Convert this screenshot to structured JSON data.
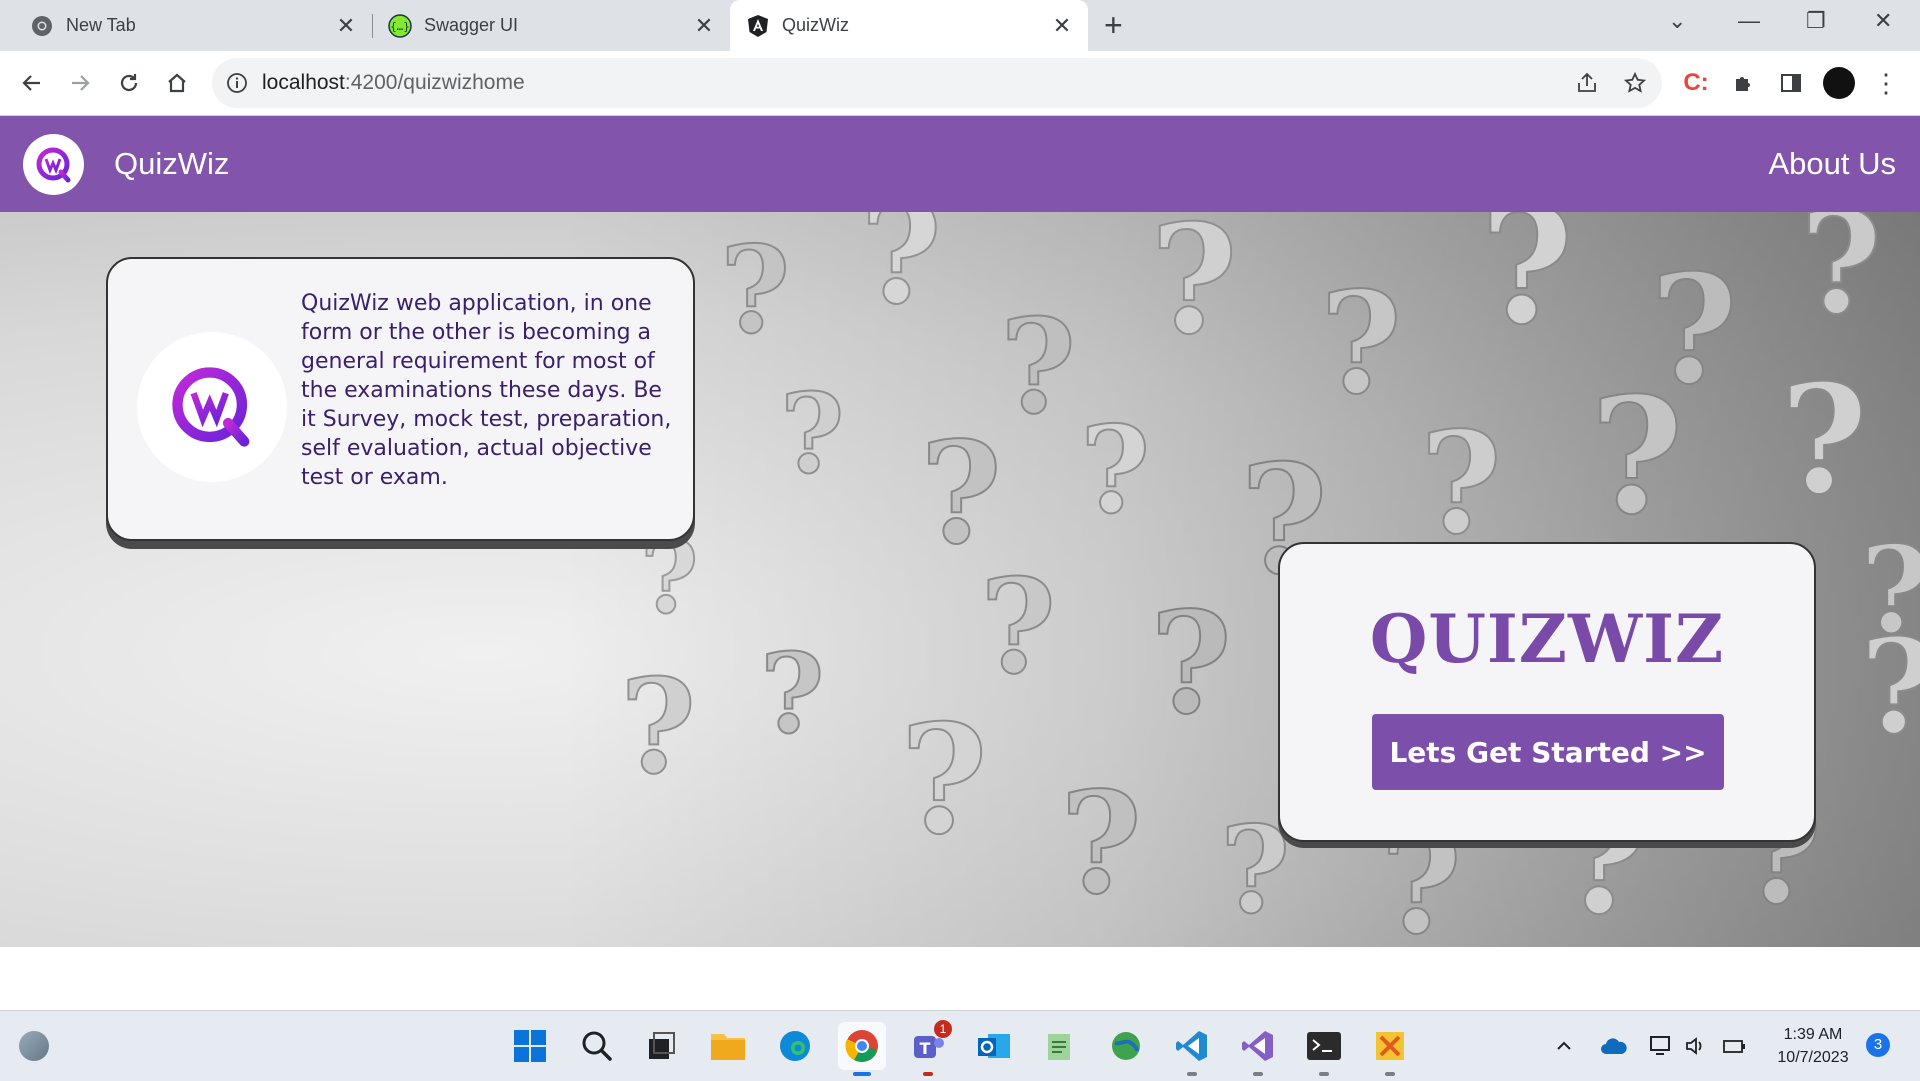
{
  "browser": {
    "tabs": [
      {
        "title": "New Tab",
        "icon": "chrome-icon"
      },
      {
        "title": "Swagger UI",
        "icon": "swagger-icon"
      },
      {
        "title": "QuizWiz",
        "icon": "angular-icon",
        "active": true
      }
    ],
    "url_host": "localhost",
    "url_path": ":4200/quizwizhome"
  },
  "app": {
    "title": "QuizWiz",
    "nav_link": "About Us",
    "brand_color": "#8254ab",
    "info_text": "QuizWiz web application, in one form or the other is becoming a general requirement for most of the examinations these days. Be it Survey, mock test, preparation, self evaluation, actual objective test or exam.",
    "cta_title": "QUIZWIZ",
    "cta_button": "Lets Get Started >>"
  },
  "taskbar": {
    "apps": [
      "windows-start-icon",
      "search-icon",
      "task-view-icon",
      "file-explorer-icon",
      "edge-icon",
      "chrome-icon",
      "teams-icon",
      "outlook-icon",
      "notepad-icon",
      "globe-icon",
      "vscode-icon",
      "visual-studio-icon",
      "terminal-icon",
      "tools-icon"
    ],
    "teams_badge": "1",
    "time": "1:39 AM",
    "date": "10/7/2023",
    "notification_count": "3"
  }
}
